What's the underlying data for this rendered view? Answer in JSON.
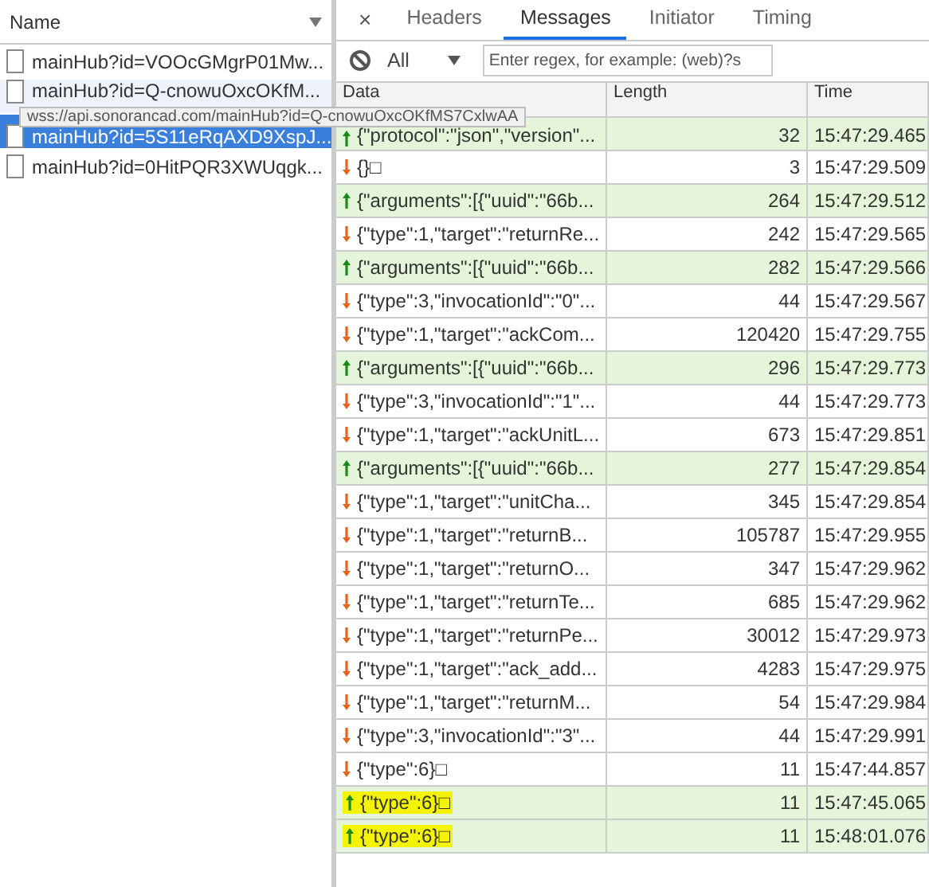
{
  "requests": {
    "header": "Name",
    "rows": [
      {
        "name": "mainHub?id=VOOcGMgrP01Mw...",
        "selected": false,
        "hovered": false
      },
      {
        "name": "mainHub?id=Q-cnowuOxcOKfM...",
        "selected": false,
        "hovered": true
      },
      {
        "name": "mainHub?id=5S11eRqAXD9XspJ...",
        "selected": true,
        "hovered": false
      },
      {
        "name": "mainHub?id=0HitPQR3XWUqgk...",
        "selected": false,
        "hovered": false
      }
    ],
    "tooltip": "wss://api.sonorancad.com/mainHub?id=Q-cnowuOxcOKfMS7CxlwAA"
  },
  "close": "×",
  "tabs": [
    {
      "label": "Headers",
      "selected": false
    },
    {
      "label": "Messages",
      "selected": true
    },
    {
      "label": "Initiator",
      "selected": false
    },
    {
      "label": "Timing",
      "selected": false
    }
  ],
  "filter": {
    "type": "All",
    "placeholder": "Enter regex, for example: (web)?s"
  },
  "table": {
    "columns": [
      "Data",
      "Length",
      "Time"
    ],
    "rows": [
      {
        "kind": "sent",
        "data": "{\"protocol\":\"json\",\"version\"...",
        "length": "32",
        "time": "15:47:29.465",
        "highlighted": false
      },
      {
        "kind": "received",
        "data": "{}□",
        "length": "3",
        "time": "15:47:29.509",
        "highlighted": false
      },
      {
        "kind": "sent",
        "data": "{\"arguments\":[{\"uuid\":\"66b...",
        "length": "264",
        "time": "15:47:29.512",
        "highlighted": false
      },
      {
        "kind": "received",
        "data": "{\"type\":1,\"target\":\"returnRe...",
        "length": "242",
        "time": "15:47:29.565",
        "highlighted": false
      },
      {
        "kind": "sent",
        "data": "{\"arguments\":[{\"uuid\":\"66b...",
        "length": "282",
        "time": "15:47:29.566",
        "highlighted": false
      },
      {
        "kind": "received",
        "data": "{\"type\":3,\"invocationId\":\"0\"...",
        "length": "44",
        "time": "15:47:29.567",
        "highlighted": false
      },
      {
        "kind": "received",
        "data": "{\"type\":1,\"target\":\"ackCom...",
        "length": "120420",
        "time": "15:47:29.755",
        "highlighted": false
      },
      {
        "kind": "sent",
        "data": "{\"arguments\":[{\"uuid\":\"66b...",
        "length": "296",
        "time": "15:47:29.773",
        "highlighted": false
      },
      {
        "kind": "received",
        "data": "{\"type\":3,\"invocationId\":\"1\"...",
        "length": "44",
        "time": "15:47:29.773",
        "highlighted": false
      },
      {
        "kind": "received",
        "data": "{\"type\":1,\"target\":\"ackUnitL...",
        "length": "673",
        "time": "15:47:29.851",
        "highlighted": false
      },
      {
        "kind": "sent",
        "data": "{\"arguments\":[{\"uuid\":\"66b...",
        "length": "277",
        "time": "15:47:29.854",
        "highlighted": false
      },
      {
        "kind": "received",
        "data": "{\"type\":1,\"target\":\"unitCha...",
        "length": "345",
        "time": "15:47:29.854",
        "highlighted": false
      },
      {
        "kind": "received",
        "data": "{\"type\":1,\"target\":\"returnB...",
        "length": "105787",
        "time": "15:47:29.955",
        "highlighted": false
      },
      {
        "kind": "received",
        "data": "{\"type\":1,\"target\":\"returnO...",
        "length": "347",
        "time": "15:47:29.962",
        "highlighted": false
      },
      {
        "kind": "received",
        "data": "{\"type\":1,\"target\":\"returnTe...",
        "length": "685",
        "time": "15:47:29.962",
        "highlighted": false
      },
      {
        "kind": "received",
        "data": "{\"type\":1,\"target\":\"returnPe...",
        "length": "30012",
        "time": "15:47:29.973",
        "highlighted": false
      },
      {
        "kind": "received",
        "data": "{\"type\":1,\"target\":\"ack_add...",
        "length": "4283",
        "time": "15:47:29.975",
        "highlighted": false
      },
      {
        "kind": "received",
        "data": "{\"type\":1,\"target\":\"returnM...",
        "length": "54",
        "time": "15:47:29.984",
        "highlighted": false
      },
      {
        "kind": "received",
        "data": "{\"type\":3,\"invocationId\":\"3\"...",
        "length": "44",
        "time": "15:47:29.991",
        "highlighted": false
      },
      {
        "kind": "received",
        "data": "{\"type\":6}□",
        "length": "11",
        "time": "15:47:44.857",
        "highlighted": false
      },
      {
        "kind": "sent",
        "data": "{\"type\":6}□",
        "length": "11",
        "time": "15:47:45.065",
        "highlighted": true
      },
      {
        "kind": "sent",
        "data": "{\"type\":6}□",
        "length": "11",
        "time": "15:48:01.076",
        "highlighted": true
      }
    ]
  }
}
